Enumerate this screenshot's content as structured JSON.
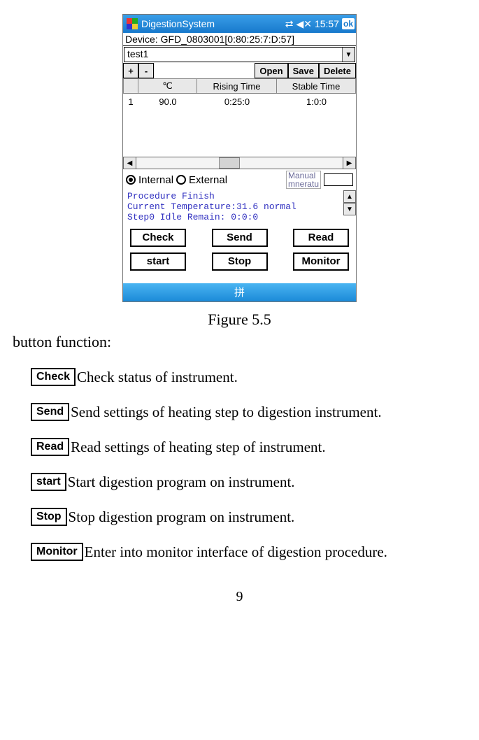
{
  "titlebar": {
    "title": "DigestionSystem",
    "time": "15:57",
    "ok": "ok"
  },
  "device_line": "Device: GFD_0803001[0:80:25:7:D:57]",
  "selector": {
    "value": "test1"
  },
  "toolbar": {
    "plus": "+",
    "minus": "-",
    "open": "Open",
    "save": "Save",
    "delete": "Delete"
  },
  "table": {
    "headers": {
      "temp": "℃",
      "rising": "Rising Time",
      "stable": "Stable Time"
    },
    "rows": [
      {
        "idx": "1",
        "temp": "90.0",
        "rising": "0:25:0",
        "stable": "1:0:0"
      }
    ]
  },
  "radios": {
    "internal": "Internal",
    "external": "External",
    "manual": "Manual\nmneratu"
  },
  "log": "Procedure Finish\nCurrent Temperature:31.6 normal\nStep0 Idle Remain: 0:0:0",
  "buttons": {
    "check": "Check",
    "send": "Send",
    "read": "Read",
    "start": "start",
    "stop": "Stop",
    "monitor": "Monitor"
  },
  "ime": "拼",
  "figure_caption": "Figure 5.5",
  "bf_title": "button function:",
  "bf": [
    {
      "btn": "Check",
      "desc": "Check status of instrument."
    },
    {
      "btn": "Send",
      "desc": "Send settings of heating step to digestion instrument."
    },
    {
      "btn": "Read",
      "desc": "Read settings of heating step of instrument."
    },
    {
      "btn": "start",
      "desc": "Start digestion program on instrument."
    },
    {
      "btn": "Stop",
      "desc": "Stop digestion program on instrument."
    },
    {
      "btn": "Monitor",
      "desc": "Enter into monitor interface of digestion procedure."
    }
  ],
  "page_number": "9"
}
